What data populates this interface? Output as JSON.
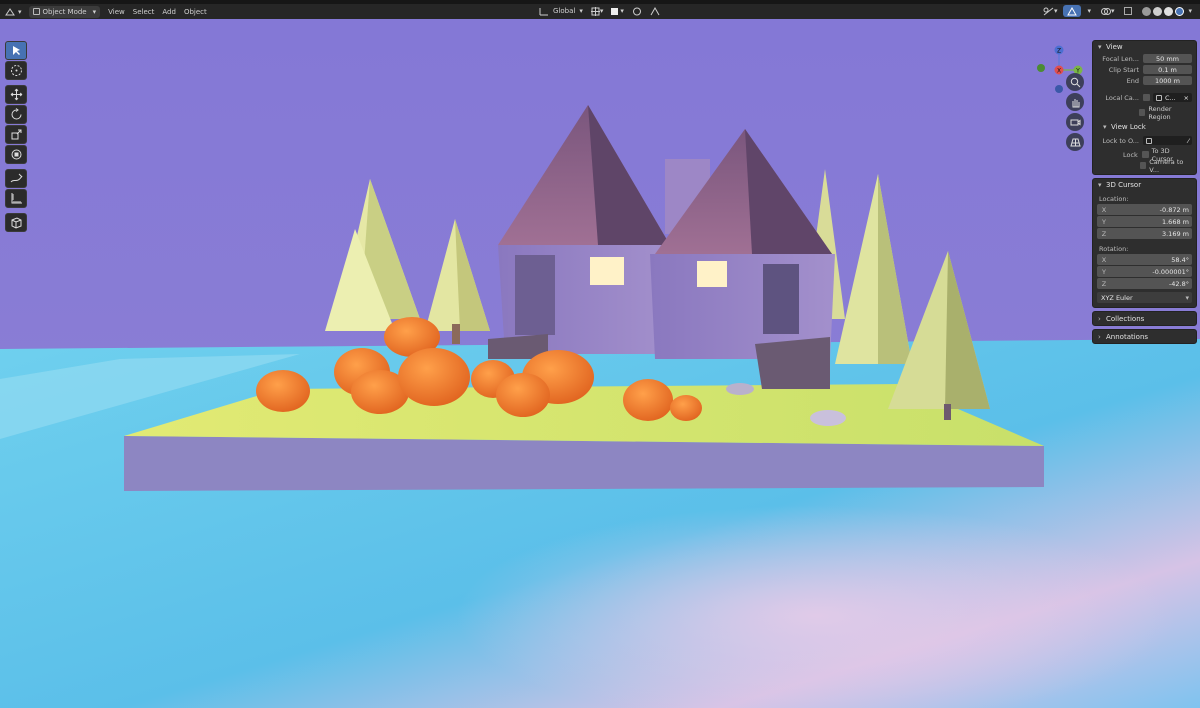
{
  "header": {
    "mode_label": "Object Mode",
    "menus": [
      "View",
      "Select",
      "Add",
      "Object"
    ],
    "orientation_label": "Global"
  },
  "toolbar": {
    "tools": [
      "select-box-icon",
      "cursor-icon",
      "move-icon",
      "rotate-icon",
      "scale-icon",
      "transform-icon",
      "annotate-icon",
      "measure-icon",
      "add-cube-icon"
    ]
  },
  "gizmo": {
    "z": "Z",
    "x": "X",
    "y": "Y"
  },
  "panel_view": {
    "title": "View",
    "focal_length_label": "Focal Len...",
    "focal_length_value": "50 mm",
    "clip_start_label": "Clip Start",
    "clip_start_value": "0.1 m",
    "end_label": "End",
    "end_value": "1000 m",
    "local_camera_label": "Local Ca...",
    "local_camera_value": "C...",
    "render_region_label": "Render Region",
    "view_lock_title": "View Lock",
    "lock_to_object_label": "Lock to O...",
    "lock_label": "Lock",
    "to_3d_cursor_label": "To 3D Cursor",
    "camera_to_view_label": "Camera to V..."
  },
  "panel_cursor": {
    "title": "3D Cursor",
    "location_label": "Location:",
    "location": [
      {
        "axis": "X",
        "value": "-0.872 m"
      },
      {
        "axis": "Y",
        "value": "1.668 m"
      },
      {
        "axis": "Z",
        "value": "3.169 m"
      }
    ],
    "rotation_label": "Rotation:",
    "rotation": [
      {
        "axis": "X",
        "value": "58.4°"
      },
      {
        "axis": "Y",
        "value": "-0.000001°"
      },
      {
        "axis": "Z",
        "value": "-42.8°"
      }
    ],
    "rotation_mode": "XYZ Euler"
  },
  "panel_collections": {
    "title": "Collections"
  },
  "panel_annotations": {
    "title": "Annotations"
  },
  "colors": {
    "accent": "#4772b3",
    "sky": "#8b7fd3",
    "ground": "#55b8e6"
  }
}
